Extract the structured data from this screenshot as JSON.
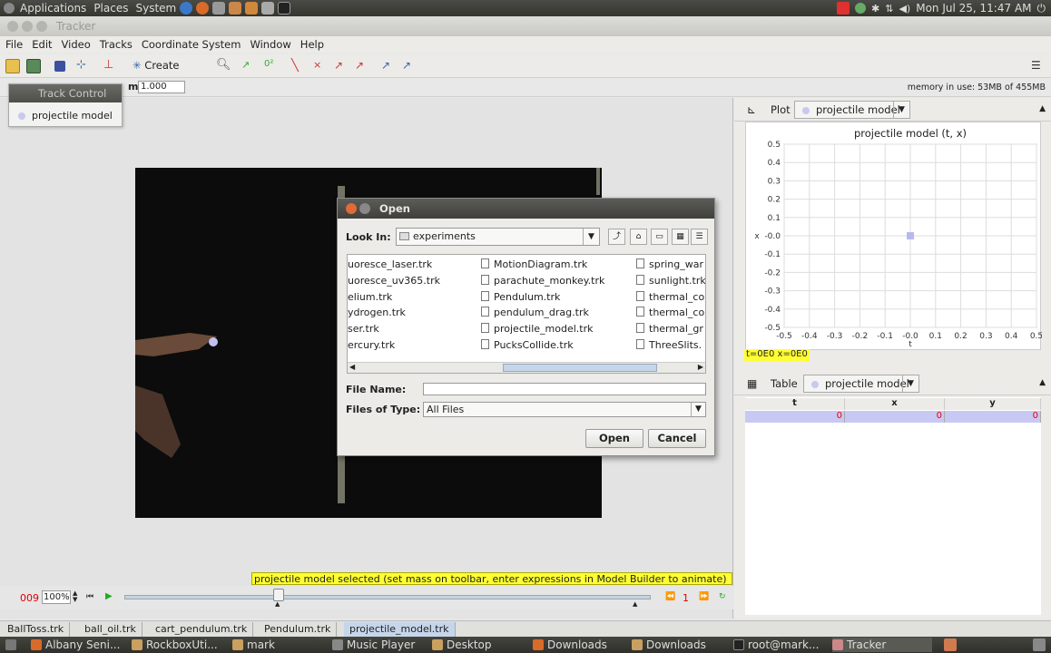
{
  "system_panel": {
    "applications": "Applications",
    "places": "Places",
    "system": "System",
    "clock": "Mon Jul 25, 11:47 AM"
  },
  "window": {
    "title": "Tracker"
  },
  "menubar": [
    "File",
    "Edit",
    "Video",
    "Tracks",
    "Coordinate System",
    "Window",
    "Help"
  ],
  "toolbar": {
    "create_label": "Create",
    "mass_label": "m",
    "mass_value": "1.000",
    "memory": "memory in use: 53MB of 455MB"
  },
  "track_control": {
    "title": "Track Control",
    "items": [
      "projectile model"
    ]
  },
  "open_dialog": {
    "title": "Open",
    "look_in_label": "Look In:",
    "look_in_value": "experiments",
    "files_col1": [
      "uoresce_laser.trk",
      "uoresce_uv365.trk",
      "elium.trk",
      "ydrogen.trk",
      "ser.trk",
      "ercury.trk"
    ],
    "files_col2": [
      "MotionDiagram.trk",
      "parachute_monkey.trk",
      "Pendulum.trk",
      "pendulum_drag.trk",
      "projectile_model.trk",
      "PucksCollide.trk"
    ],
    "files_col3": [
      "spring_war",
      "sunlight.trk",
      "thermal_co",
      "thermal_co",
      "thermal_gr",
      "ThreeSlits."
    ],
    "file_name_label": "File Name:",
    "file_name_value": "",
    "files_of_type_label": "Files of Type:",
    "files_of_type_value": "All Files",
    "open_button": "Open",
    "cancel_button": "Cancel"
  },
  "status_message": "projectile model selected (set mass on toolbar, enter expressions in Model Builder to animate)",
  "playback": {
    "frame": "009",
    "zoom": "100%",
    "step": "1"
  },
  "plot_panel": {
    "label": "Plot",
    "track": "projectile model",
    "readout": "t=0E0  x=0E0"
  },
  "table_panel": {
    "label": "Table",
    "track": "projectile model",
    "columns": [
      "t",
      "x",
      "y"
    ],
    "row": [
      "0",
      "0",
      "0"
    ]
  },
  "chart_data": {
    "type": "scatter",
    "title": "projectile model (t, x)",
    "xlabel": "t",
    "ylabel": "x",
    "xlim": [
      -0.5,
      0.5
    ],
    "ylim": [
      -0.5,
      0.5
    ],
    "x_ticks": [
      "-0.5",
      "-0.4",
      "-0.3",
      "-0.2",
      "-0.1",
      "-0.0",
      "0.1",
      "0.2",
      "0.3",
      "0.4",
      "0.5"
    ],
    "y_ticks": [
      "0.5",
      "0.4",
      "0.3",
      "0.2",
      "0.1",
      "-0.0",
      "-0.1",
      "-0.2",
      "-0.3",
      "-0.4",
      "-0.5"
    ],
    "x_tick_values": [
      -0.5,
      -0.4,
      -0.3,
      -0.2,
      -0.1,
      0,
      0.1,
      0.2,
      0.3,
      0.4,
      0.5
    ],
    "y_tick_values": [
      0.5,
      0.4,
      0.3,
      0.2,
      0.1,
      0,
      -0.1,
      -0.2,
      -0.3,
      -0.4,
      -0.5
    ],
    "points": [
      {
        "x": 0,
        "y": 0
      }
    ],
    "grid": true,
    "color": "#b8b8f0"
  },
  "file_tabs": [
    "BallToss.trk",
    "ball_oil.trk",
    "cart_pendulum.trk",
    "Pendulum.trk",
    "projectile_model.trk"
  ],
  "taskbar": [
    "Albany Seni...",
    "RockboxUti...",
    "mark",
    "Music Player",
    "Desktop",
    "Downloads",
    "Downloads",
    "root@mark...",
    "Tracker"
  ]
}
